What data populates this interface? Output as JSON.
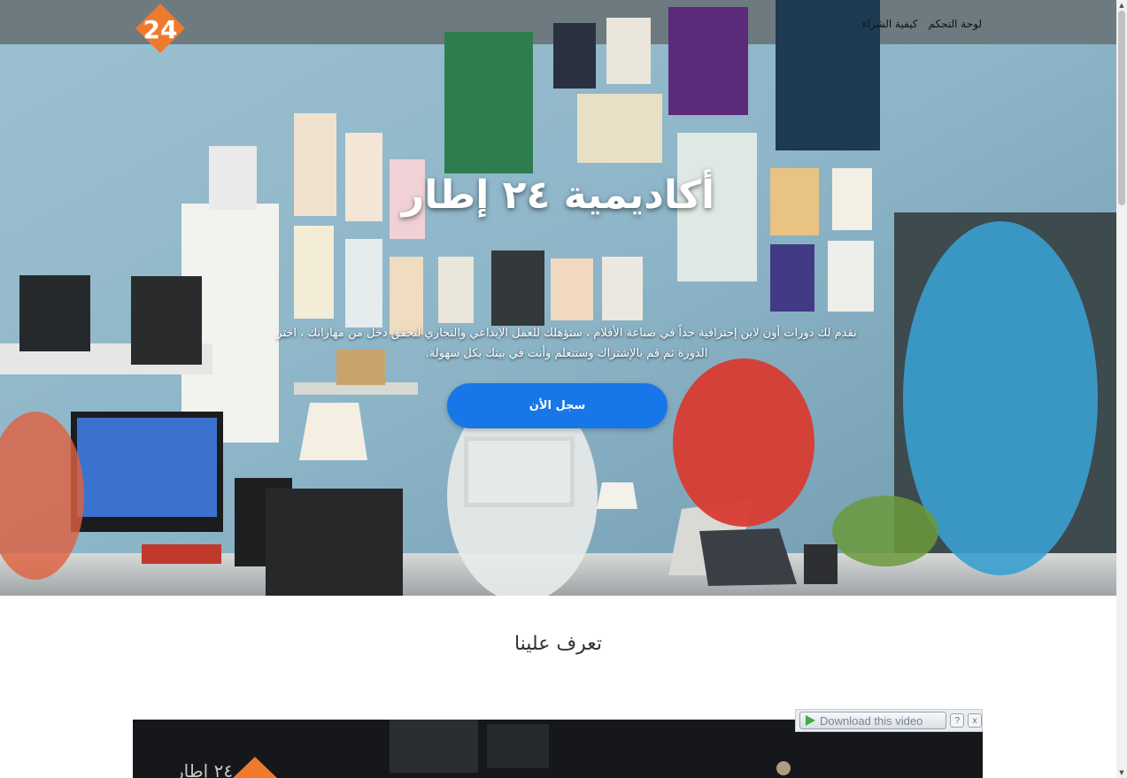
{
  "nav": {
    "items": [
      "لوحة التحكم",
      "كيفية الشراء"
    ]
  },
  "hero": {
    "title": "أكاديمية ٢٤ إطار",
    "description": "نقدم لك دورات أون لاين إحترافية جداً في صناعة الأفلام ، ستؤهلك للعمل الإبداعي والتجاري لتحقق دخل من مهاراتك ، اختر الدورة ثم قم بالإشتراك وستتعلم وأنت في بيتك بكل سهولة.",
    "cta_label": "سجل الأن"
  },
  "about": {
    "title": "تعرف علينا"
  },
  "video": {
    "brand_text": "٢٤ إطار"
  },
  "download_bar": {
    "button_label": "Download this video",
    "help_label": "?",
    "close_label": "x"
  },
  "logo": {
    "digits": "24"
  },
  "colors": {
    "accent": "#1877e8",
    "logo": "#f07a2c"
  }
}
